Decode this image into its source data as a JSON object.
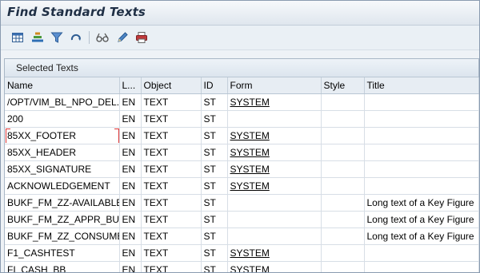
{
  "window": {
    "title": "Find Standard Texts"
  },
  "toolbar": {
    "buttons": [
      {
        "icon": "table-settings-icon"
      },
      {
        "icon": "sort-icon"
      },
      {
        "icon": "filter-icon"
      },
      {
        "icon": "refresh-icon"
      },
      {
        "icon": "display-glasses-icon"
      },
      {
        "icon": "edit-pencil-icon"
      },
      {
        "icon": "print-icon"
      }
    ]
  },
  "panel": {
    "title": "Selected Texts",
    "columns": [
      "Name",
      "L...",
      "Object",
      "ID",
      "Form",
      "Style",
      "Title"
    ],
    "rows": [
      {
        "name": "/OPT/VIM_BL_NPO_DEL...",
        "lang": "EN",
        "object": "TEXT",
        "id": "ST",
        "form": "SYSTEM",
        "style": "",
        "title": ""
      },
      {
        "name": "200",
        "lang": "EN",
        "object": "TEXT",
        "id": "ST",
        "form": "",
        "style": "",
        "title": ""
      },
      {
        "name": "85XX_FOOTER",
        "lang": "EN",
        "object": "TEXT",
        "id": "ST",
        "form": "SYSTEM",
        "style": "",
        "title": ""
      },
      {
        "name": "85XX_HEADER",
        "lang": "EN",
        "object": "TEXT",
        "id": "ST",
        "form": "SYSTEM",
        "style": "",
        "title": ""
      },
      {
        "name": "85XX_SIGNATURE",
        "lang": "EN",
        "object": "TEXT",
        "id": "ST",
        "form": "SYSTEM",
        "style": "",
        "title": ""
      },
      {
        "name": "ACKNOWLEDGEMENT",
        "lang": "EN",
        "object": "TEXT",
        "id": "ST",
        "form": "SYSTEM",
        "style": "",
        "title": ""
      },
      {
        "name": "BUKF_FM_ZZ-AVAILABLE",
        "lang": "EN",
        "object": "TEXT",
        "id": "ST",
        "form": "",
        "style": "",
        "title": "Long text of a Key Figure"
      },
      {
        "name": "BUKF_FM_ZZ_APPR_BUD",
        "lang": "EN",
        "object": "TEXT",
        "id": "ST",
        "form": "",
        "style": "",
        "title": "Long text of a Key Figure"
      },
      {
        "name": "BUKF_FM_ZZ_CONSUME",
        "lang": "EN",
        "object": "TEXT",
        "id": "ST",
        "form": "",
        "style": "",
        "title": "Long text of a Key Figure"
      },
      {
        "name": "F1_CASHTEST",
        "lang": "EN",
        "object": "TEXT",
        "id": "ST",
        "form": "SYSTEM",
        "style": "",
        "title": ""
      },
      {
        "name": "FI_CASH_BB",
        "lang": "EN",
        "object": "TEXT",
        "id": "ST",
        "form": "SYSTEM",
        "style": "",
        "title": ""
      }
    ]
  }
}
